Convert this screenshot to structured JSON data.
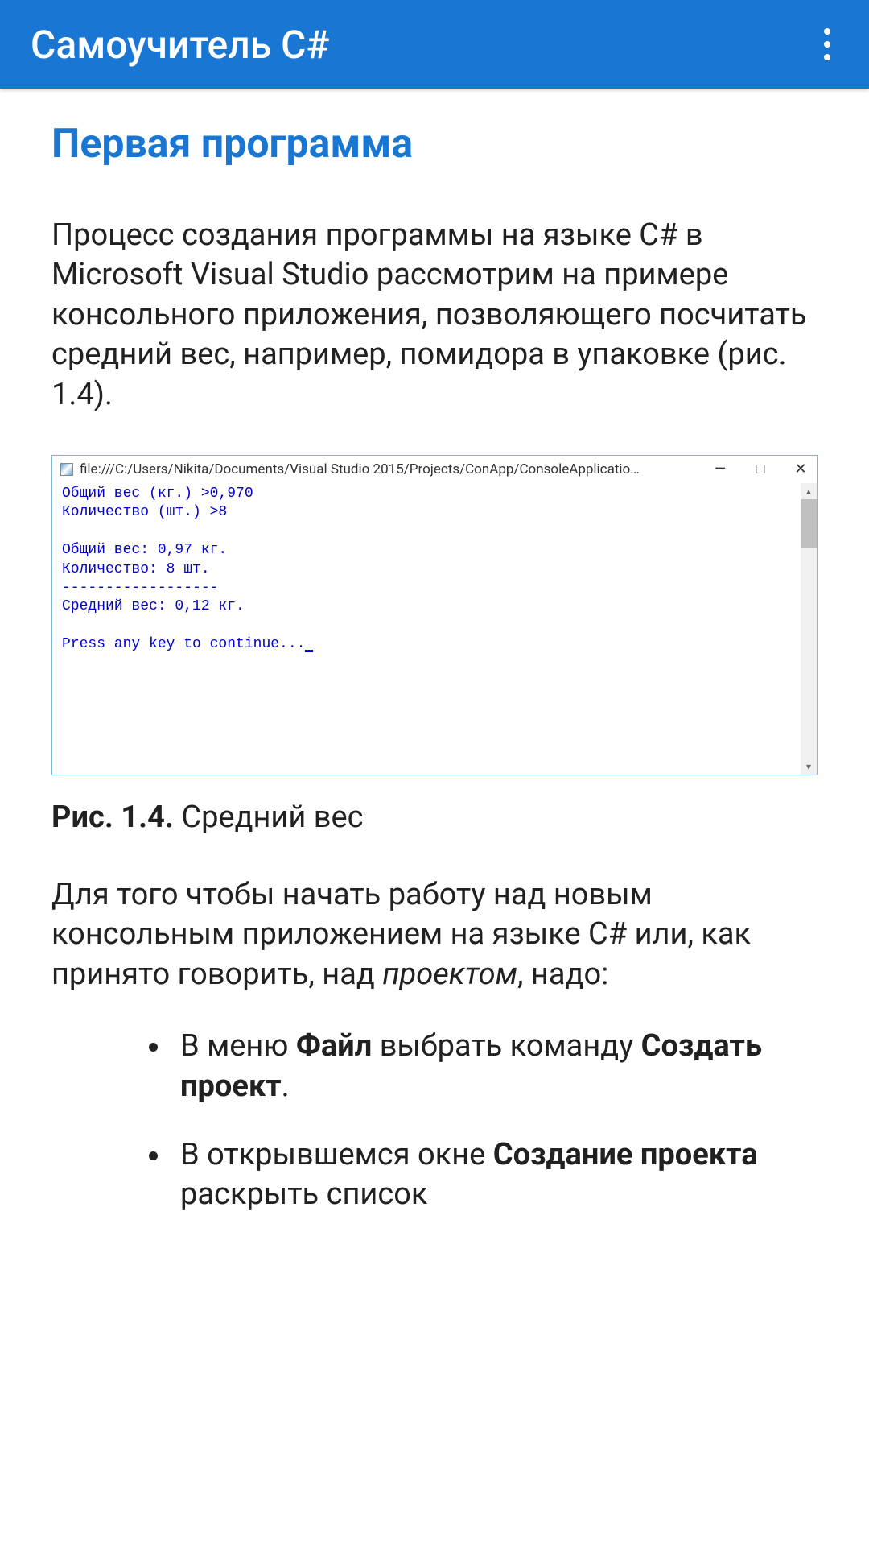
{
  "header": {
    "title": "Самоучитель C#"
  },
  "page": {
    "title": "Первая программа",
    "intro": "Процесс создания программы на языке C# в Microsoft Visual Studio рассмотрим на примере консольного приложения, позволяющего посчитать средний вес, например, помидора в упаковке (рис. 1.4)."
  },
  "console": {
    "title": "file:///C:/Users/Nikita/Documents/Visual Studio 2015/Projects/ConApp/ConsoleApplicatio…",
    "lines": {
      "l1": "Общий вес (кг.) >0,970",
      "l2": "Количество (шт.) >8",
      "l3": "",
      "l4": "Общий вес: 0,97 кг.",
      "l5": "Количество: 8 шт.",
      "l6": "------------------",
      "l7": "Средний вес: 0,12 кг.",
      "l8": "",
      "l9": "Press any key to continue..."
    },
    "controls": {
      "minimize": "—",
      "maximize": "□",
      "close": "✕"
    }
  },
  "caption": {
    "label": "Рис. 1.4.",
    "text": " Средний вес"
  },
  "body": {
    "p1a": "Для того чтобы начать работу над новым консольным приложением на языке C# или, как принято говорить, над ",
    "p1italic": "проектом",
    "p1b": ", надо:"
  },
  "list": {
    "item1": {
      "a": "В меню ",
      "bold1": "Файл",
      "b": " выбрать команду ",
      "bold2": "Создать проект",
      "c": "."
    },
    "item2": {
      "a": "В открывшемся окне ",
      "bold1": "Создание проекта",
      "b": " раскрыть список"
    }
  }
}
